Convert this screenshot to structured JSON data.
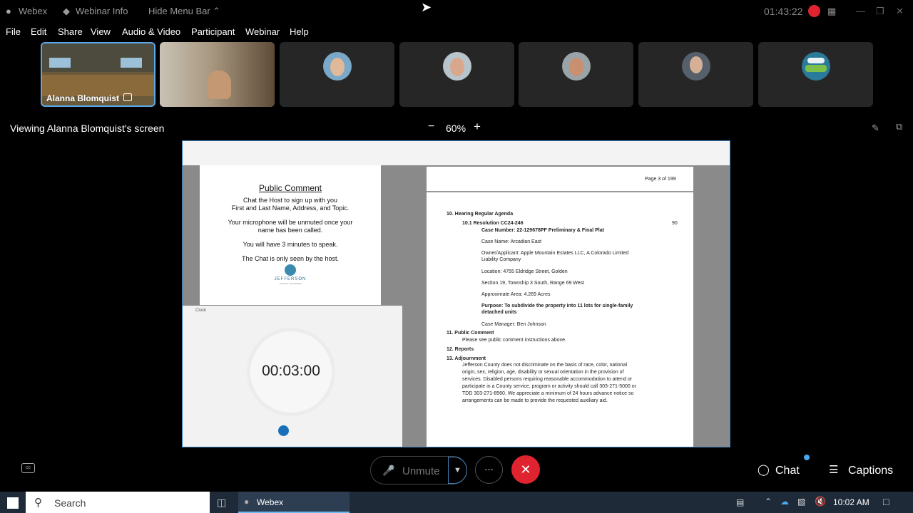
{
  "titlebar": {
    "app": "Webex",
    "info": "Webinar Info",
    "hide": "Hide Menu Bar",
    "timer": "01:43:22"
  },
  "menu": [
    "File",
    "Edit",
    "Share",
    "View",
    "Audio & Video",
    "Participant",
    "Webinar",
    "Help"
  ],
  "participants": {
    "active_name": "Alanna Blomquist"
  },
  "viewing": {
    "label": "Viewing Alanna Blomquist's screen",
    "zoom": "60%",
    "minus": "−",
    "plus": "+"
  },
  "left_pdf": {
    "title": "Public Comment",
    "lines": [
      "Chat the Host to sign up with you",
      "First and Last Name, Address, and Topic.",
      "Your microphone will be unmuted once your",
      "name has been called.",
      "You will have 3 minutes to speak.",
      "The Chat is only seen by the host."
    ],
    "logo": "JEFFERSON",
    "logo_sub": "COUNTY COLORADO"
  },
  "clock": {
    "title": "Clock",
    "time": "00:03:00"
  },
  "right_pdf": {
    "page": "Page 3 of 199",
    "items": [
      {
        "t": "10.    Hearing Regular Agenda",
        "b": true
      },
      {
        "t": "10.1      Resolution CC24-246",
        "b": true
      },
      {
        "t": "90",
        "b": false
      },
      {
        "t": "Case Number:  22-129678PF Preliminary & Final Plat",
        "b": true
      },
      {
        "t": "Case Name: Arcadian East",
        "b": false
      },
      {
        "t": "Owner/Applicant: Apple Mountain Estates LLC, A Colorado Limited",
        "b": false
      },
      {
        "t": "Liability Company",
        "b": false
      },
      {
        "t": "Location: 4755 Eldridge Street, Golden",
        "b": false
      },
      {
        "t": "Section 19, Township 3 South, Range 69 West",
        "b": false
      },
      {
        "t": "Approximate Area: 4.269 Acres",
        "b": false
      },
      {
        "t": "Purpose: To subdivide the property into 11 lots for single-family",
        "b": true
      },
      {
        "t": "detached units",
        "b": true
      },
      {
        "t": "Case Manager: Ben Johnson",
        "b": false
      },
      {
        "t": "11.    Public Comment",
        "b": true
      },
      {
        "t": "Please see public comment instructions above.",
        "b": false
      },
      {
        "t": "12.    Reports",
        "b": true
      },
      {
        "t": "13.    Adjournment",
        "b": true
      },
      {
        "t": "Jefferson County does not discriminate on the basis of race, color, national",
        "b": false
      },
      {
        "t": "origin, sex, religion, age, disability or sexual orientation in the provision of",
        "b": false
      },
      {
        "t": "services.  Disabled persons requiring reasonable accommodation to attend or",
        "b": false
      },
      {
        "t": "participate in a County service, program or activity should call 303-271-5000 or",
        "b": false
      },
      {
        "t": "TDD 303-271-8560.  We appreciate a minimum of 24 hours advance notice so",
        "b": false
      },
      {
        "t": "arrangements can be made to provide the requested auxiliary aid.",
        "b": false
      }
    ]
  },
  "controls": {
    "unmute": "Unmute",
    "chat": "Chat",
    "captions": "Captions",
    "more": "···"
  },
  "taskbar": {
    "search": "Search",
    "app": "Webex",
    "time": "10:02 AM"
  },
  "colors": {
    "accent": "#3a7fb8",
    "end": "#e0242f",
    "record": "#e0242f"
  }
}
